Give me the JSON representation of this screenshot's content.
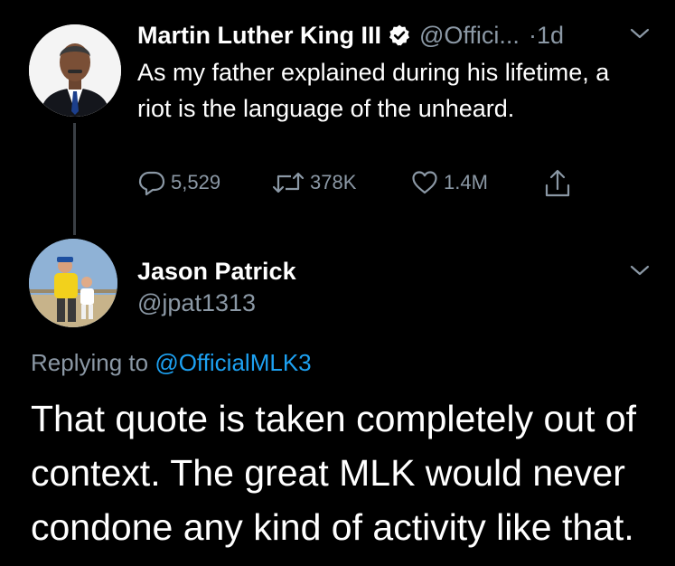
{
  "tweet1": {
    "author_name": "Martin Luther King III",
    "handle": "@Offici...",
    "separator": "·",
    "time": "1d",
    "text": "As my father explained during his lifetime, a riot is the language of the unheard.",
    "counts": {
      "replies": "5,529",
      "retweets": "378K",
      "likes": "1.4M"
    },
    "icons": {
      "verified": "verified-badge-icon",
      "menu": "chevron-down-icon",
      "reply": "reply-bubble-icon",
      "retweet": "retweet-icon",
      "like": "heart-icon",
      "share": "share-icon"
    }
  },
  "tweet2": {
    "author_name": "Jason Patrick",
    "handle": "@jpat1313",
    "replying_prefix": "Replying to",
    "replying_to": "@OfficialMLK3",
    "text": "That quote is taken completely out of context. The great MLK would never condone any kind of activity like that."
  },
  "colors": {
    "background": "#000000",
    "primary_text": "#ffffff",
    "secondary_text": "#8b98a5",
    "link": "#1da1f2",
    "thread_line": "#3a3f45"
  }
}
